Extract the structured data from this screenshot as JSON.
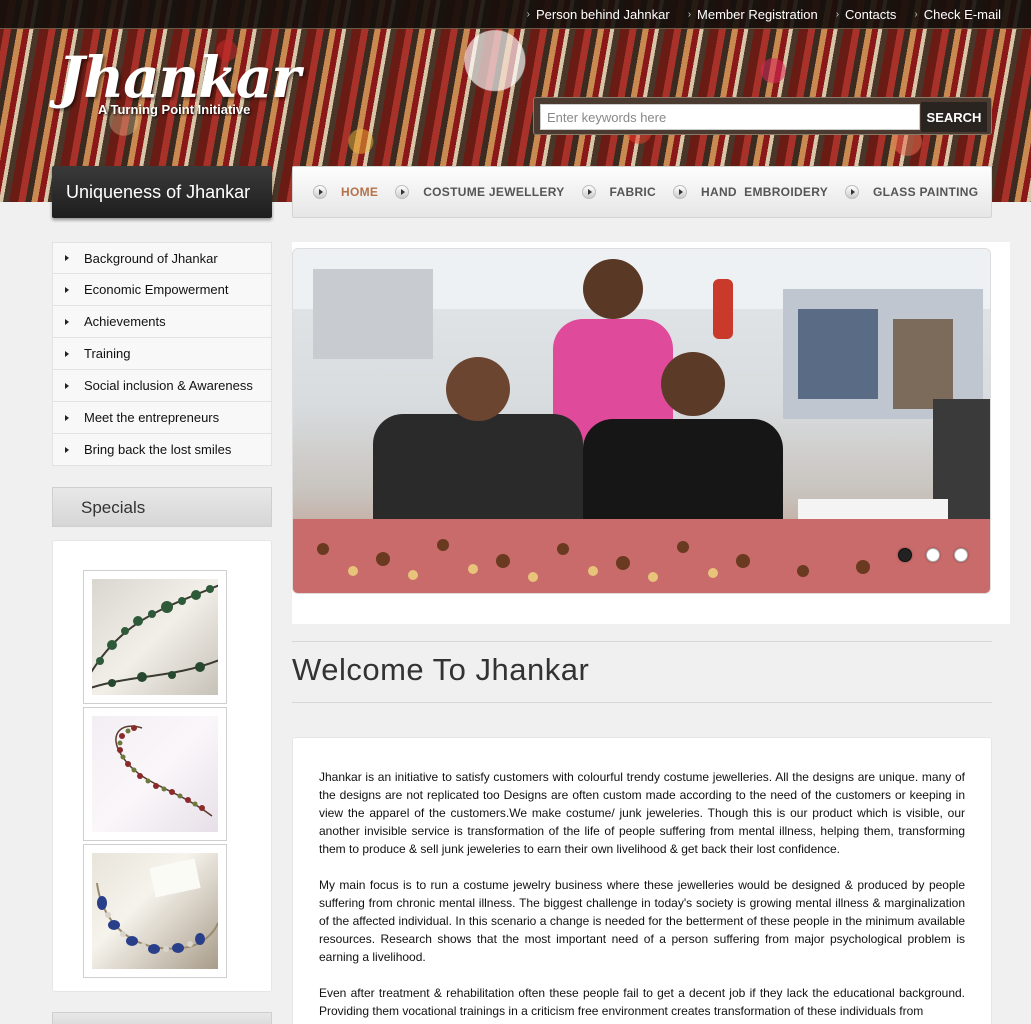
{
  "top_nav": [
    "Person behind Jahnkar",
    "Member Registration",
    "Contacts",
    "Check E-mail"
  ],
  "logo": {
    "name": "Jhankar",
    "tagline": "A Turning Point Initiative"
  },
  "search": {
    "placeholder": "Enter keywords here",
    "button": "SEARCH"
  },
  "section_title": "Uniqueness of Jhankar",
  "main_nav": [
    "HOME",
    "COSTUME JEWELLERY",
    "FABRIC",
    "HAND  EMBROIDERY",
    "GLASS PAINTING"
  ],
  "main_nav_active": "HOME",
  "sidebar_menu": [
    "Background of Jhankar",
    "Economic Empowerment",
    "Achievements",
    "Training",
    "Social inclusion & Awareness",
    "Meet the entrepreneurs",
    "Bring back the lost smiles"
  ],
  "specials": {
    "title": "Specials"
  },
  "slider": {
    "slide_count": 3,
    "active_slide": 1
  },
  "welcome": "Welcome To Jhankar",
  "paragraphs": [
    "Jhankar is an initiative to satisfy customers with colourful trendy costume jewelleries. All the designs are unique. many of the designs are not replicated too Designs are often custom made according to the need of the customers or keeping in view the apparel of the customers.We make costume/ junk jeweleries. Though this is our product which is visible, our another invisible service is transformation of the life of people suffering from mental illness, helping them, transforming them to produce & sell junk jeweleries to earn their own livelihood & get back their lost confidence.",
    "My main focus is to run a costume jewelry business where these jewelleries would be designed & produced by people suffering from chronic mental illness. The biggest challenge in today's society is growing mental illness & marginalization of the affected individual. In this scenario a change is needed for the betterment of these people in the minimum available resources. Research shows that the most important need of a person suffering from major psychological problem is earning a livelihood.",
    "Even after treatment & rehabilitation often these people fail to get a decent job if they lack the educational background. Providing them vocational trainings in a criticism free environment creates transformation of these individuals from"
  ],
  "colors": {
    "nav_active": "#b5724a",
    "title_bar": "#1e1e1e"
  }
}
